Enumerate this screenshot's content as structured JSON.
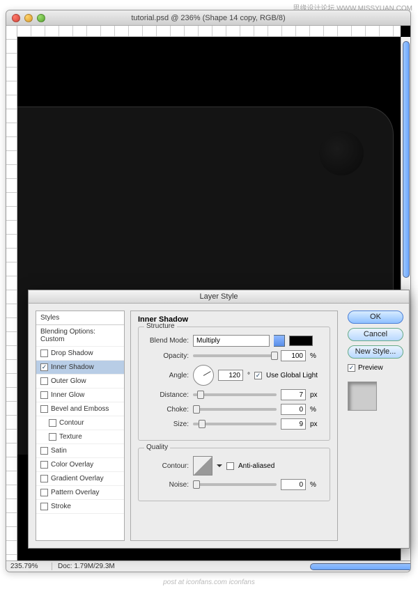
{
  "watermark": "思缘设计论坛 WWW.MISSYUAN.COM",
  "window": {
    "title": "tutorial.psd @ 236% (Shape 14 copy, RGB/8)"
  },
  "status": {
    "zoom": "235.79%",
    "doc_label": "Doc:",
    "doc_size": "1.79M/29.3M"
  },
  "dialog": {
    "title": "Layer Style",
    "sidebar": {
      "header": "Styles",
      "blending": "Blending Options: Custom",
      "items": [
        "Drop Shadow",
        "Inner Shadow",
        "Outer Glow",
        "Inner Glow",
        "Bevel and Emboss",
        "Contour",
        "Texture",
        "Satin",
        "Color Overlay",
        "Gradient Overlay",
        "Pattern Overlay",
        "Stroke"
      ]
    },
    "panel": {
      "title": "Inner Shadow",
      "structure_label": "Structure",
      "blend_mode_label": "Blend Mode:",
      "blend_mode": "Multiply",
      "opacity_label": "Opacity:",
      "opacity": "100",
      "angle_label": "Angle:",
      "angle": "120",
      "global_light": "Use Global Light",
      "distance_label": "Distance:",
      "distance": "7",
      "choke_label": "Choke:",
      "choke": "0",
      "size_label": "Size:",
      "size": "9",
      "quality_label": "Quality",
      "contour_label": "Contour:",
      "antialiased": "Anti-aliased",
      "noise_label": "Noise:",
      "noise": "0",
      "pct": "%",
      "px": "px"
    },
    "buttons": {
      "ok": "OK",
      "cancel": "Cancel",
      "new_style": "New Style...",
      "preview": "Preview"
    }
  },
  "footer": "post at iconfans.com iconfans"
}
